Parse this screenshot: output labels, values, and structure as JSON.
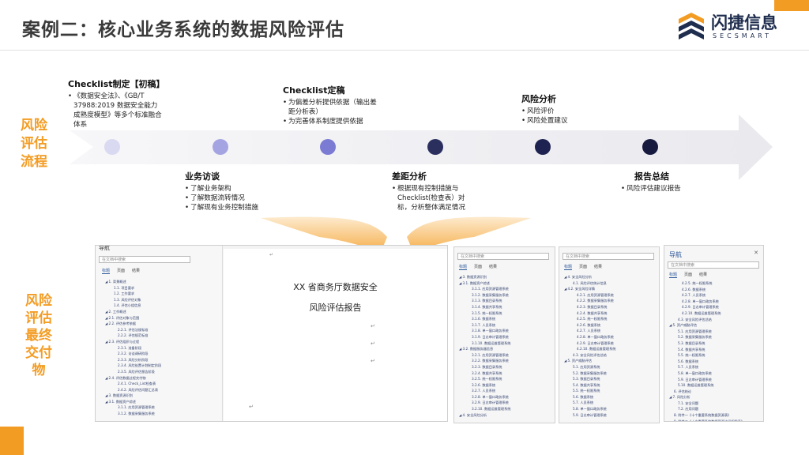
{
  "title": "案例二：核心业务系统的数据风险评估",
  "logo": {
    "name": "闪捷信息",
    "sub": "SECSMART"
  },
  "side_labels": {
    "process": "风险\n评估\n流程",
    "deliverable": "风险\n评估\n最终\n交付\n物"
  },
  "stages": [
    {
      "title": "Checklist制定【初稿】",
      "items": [
        "《数据安全法》、《GB/T 37988:2019 数据安全能力成熟度模型》等多个标准融合体系"
      ],
      "dot_color": "#d9d9f2"
    },
    {
      "title": "业务访谈",
      "items": [
        "了解业务架构",
        "了解数据流转情况",
        "了解现有业务控制措施"
      ],
      "dot_color": "#a4a4e2"
    },
    {
      "title": "Checklist定稿",
      "items": [
        "为偏差分析提供依据（输出差距分析表）",
        "为完善体系制度提供依据"
      ],
      "dot_color": "#7b7bd4"
    },
    {
      "title": "差距分析",
      "items": [
        "根据现有控制措施与Checklist(检查表）对标，分析整体满足情况"
      ],
      "dot_color": "#2a2f5e"
    },
    {
      "title": "风险分析",
      "items": [
        "风险评价",
        "风险处置建议"
      ],
      "dot_color": "#1d2250"
    },
    {
      "title": "报告总结",
      "items": [
        "风险评估建议报告"
      ],
      "dot_color": "#161a3f"
    }
  ],
  "doc_main": {
    "nav_title": "导航",
    "search_placeholder": "在文档中搜索",
    "tabs": [
      "标题",
      "页面",
      "结果"
    ],
    "outline": [
      "◢ 1. 背景概述",
      "1.1. 项目要求",
      "1.2. 工作要求",
      "1.3. 风险评估对象",
      "1.4. 评估小组信息",
      "◢ 2. 工作概述",
      "◢ 2.1. 评估对象与范围",
      "◢ 2.2. 评估参考依据",
      "2.2.1. 评估法规标准",
      "2.2.2. 评估规范标准",
      "◢ 2.3. 评估组织与过程",
      "2.3.1. 准备阶段",
      "2.3.2. 访谈调研阶段",
      "2.3.3. 风险分析阶段",
      "2.3.4. 风险处置计划制定阶段",
      "2.3.5. 风险评估报告阶段",
      "◢ 2.4. 评估数据过程交付物",
      "2.4.1. Check_List检查表",
      "2.4.2. 风险评估问题汇总表",
      "◢ 3. 数据资源识别",
      "◢ 3.1. 数据资产综述",
      "3.1.1. 应用资源管理系统",
      "3.1.2. 数据采集服务系统"
    ],
    "page_title_line1": "XX 省商务厅数据安全",
    "page_title_line2": "风险评估报告",
    "marks": [
      "↵",
      "↵",
      "↵",
      "↵",
      "↵"
    ]
  },
  "doc2": {
    "search_placeholder": "在文档中搜索",
    "tabs": [
      "标题",
      "页面",
      "结果"
    ],
    "outline": [
      "◢ 3. 数据资源识别",
      "◢ 3.1. 数据资产综述",
      "3.1.1. 应用资源管理系统",
      "3.1.2. 数据采集服务系统",
      "3.1.3. 数据目录系统",
      "3.1.4. 数据共享系统",
      "3.1.5. 统一权限系统",
      "3.1.6. 数据系统",
      "3.1.7. 人员系统",
      "3.1.8. 单一窗口政务系统",
      "3.1.9. 日志审计管理系统",
      "3.1.10. 数据运维管理系统",
      "◢ 3.2. 数据服务器信息",
      "3.2.1. 应用资源管理系统",
      "3.2.2. 数据采集服务系统",
      "3.2.3. 数据目录系统",
      "3.2.4. 数据共享系统",
      "3.2.5. 统一权限系统",
      "3.2.6. 数据系统",
      "3.2.7. 人员系统",
      "3.2.8. 单一窗口政务系统",
      "3.2.9. 日志审计管理系统",
      "3.2.10. 数据运维管理系统",
      "◢ 4. 安全风险分析"
    ]
  },
  "doc3": {
    "search_placeholder": "在文档中搜索",
    "tabs": [
      "标题",
      "页面",
      "结果"
    ],
    "outline": [
      "◢ 4. 安全风险分析",
      "4.1. 风险评估统计信息",
      "◢ 4.2. 安全风险详情",
      "4.2.1. 应用资源管理系统",
      "4.2.2. 数据采集服务系统",
      "4.2.3. 数据目录系统",
      "4.2.4. 数据共享系统",
      "4.2.5. 统一权限系统",
      "4.2.6. 数据系统",
      "4.2.7. 人员系统",
      "4.2.8. 单一窗口政务系统",
      "4.2.9. 日志审计管理系统",
      "4.2.10. 数据运维管理系统",
      "4.3. 安全风险评估总结",
      "◢ 5. 资产威胁评估",
      "5.1. 应用资源系统",
      "5.2. 数据采集服务系统",
      "5.3. 数据目录系统",
      "5.4. 数据共享系统",
      "5.5. 统一权限系统",
      "5.6. 数据系统",
      "5.7. 人员系统",
      "5.8. 单一窗口政务系统",
      "5.9. 日志审计管理系统"
    ]
  },
  "doc4": {
    "nav_title": "导航",
    "search_placeholder": "在文档中搜索",
    "tabs": [
      "标题",
      "页面",
      "结果"
    ],
    "outline": [
      "4.2.5. 统一权限系统",
      "4.2.6. 数据系统",
      "4.2.7. 人员系统",
      "4.2.8. 单一窗口政务系统",
      "4.2.9. 日志审计管理系统",
      "4.2.10. 数据运维管理系统",
      "4.3. 安全风险评估总结",
      "◢ 5. 资产威胁评估",
      "5.1. 应用资源管理系统",
      "5.2. 数据采集服务系统",
      "5.3. 数据目录系统",
      "5.4. 数据共享系统",
      "5.5. 统一权限系统",
      "5.6. 数据系统",
      "5.7. 人员系统",
      "5.8. 单一窗口政务系统",
      "5.9. 日志审计管理系统",
      "5.10. 数据运维管理系统",
      "6. 评估结论",
      "◢ 7. 风险分析",
      "7.1. 安全问题",
      "7.2. 应用问题",
      "8. 附件一《十个重要系统数据资源表》",
      "9. 附件二《十个重要系统数据资源访问权限表》"
    ]
  }
}
